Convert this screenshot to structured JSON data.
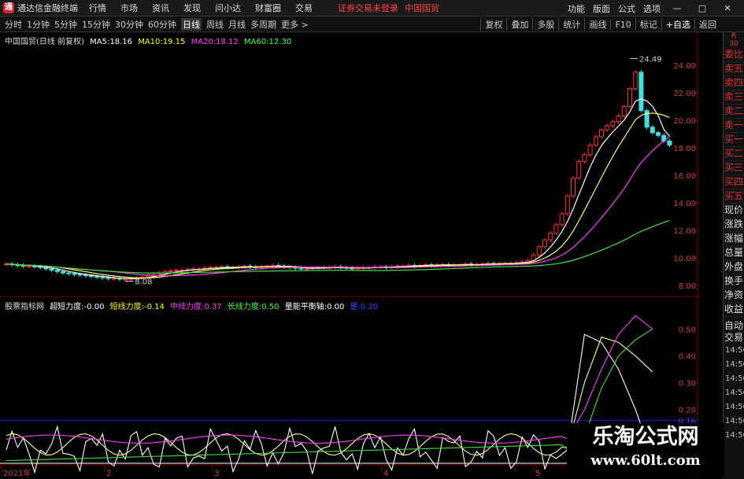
{
  "menubar": {
    "logo": "通",
    "app_title": "通达信金融终端",
    "items": [
      "行情",
      "市场",
      "资讯",
      "发现",
      "问小达",
      "财富圈",
      "交易"
    ],
    "warn1": "证券交易未登录",
    "warn2": "中国国贸",
    "right_items": [
      "功能",
      "版面",
      "公式",
      "选项"
    ],
    "window_controls": [
      "—",
      "□",
      "✕"
    ]
  },
  "toolbar": {
    "periods": [
      "分时",
      "1分钟",
      "5分钟",
      "15分钟",
      "30分钟",
      "60分钟",
      "日线",
      "周线",
      "月线",
      "多周期",
      "更多 >"
    ],
    "active_index": 6,
    "tools": [
      "复权",
      "叠加",
      "多股",
      "统计",
      "画线",
      "F10",
      "标记",
      "+自选",
      "返回"
    ]
  },
  "price_chart": {
    "name": "中国国贸(日线 前复权)",
    "ma_legend": [
      {
        "label": "MA5:",
        "value": "18.16",
        "color": "#ffffff"
      },
      {
        "label": "MA10:",
        "value": "19.15",
        "color": "#ffff00"
      },
      {
        "label": "MA20:",
        "value": "18.12",
        "color": "#ff40ff"
      },
      {
        "label": "MA60:",
        "value": "12.30",
        "color": "#40ff40"
      }
    ],
    "yticks": [
      "24.00",
      "22.00",
      "20.00",
      "18.00",
      "16.00",
      "14.00",
      "12.00",
      "10.00",
      "8.00"
    ],
    "ymin": 7.3,
    "ymax": 25.6,
    "high_label": "24.49",
    "low_label": "8.08"
  },
  "indicator": {
    "name": "股票指标网",
    "items": [
      {
        "label": "超短力度:",
        "value": "-0.00",
        "color": "#ffffff"
      },
      {
        "label": "短线力度:",
        "value": "-0.14",
        "color": "#ffff00"
      },
      {
        "label": "中线力度:",
        "value": "0.37",
        "color": "#ff40ff"
      },
      {
        "label": "长线力度:",
        "value": "0.50",
        "color": "#40ff40"
      },
      {
        "label": "量能平衡轴:",
        "value": "0.00",
        "color": "#ffffff"
      },
      {
        "label": "量:",
        "value": "0.20",
        "color": "#4040ff"
      }
    ],
    "yticks": [
      "0.50",
      "0.40",
      "0.30",
      "0.20",
      "0.16",
      "0.10"
    ],
    "cursor_value": "0.16"
  },
  "xaxis": {
    "labels": [
      "2021年",
      "2",
      "3",
      "4",
      "5"
    ]
  },
  "side": {
    "r_label": "R\n30",
    "items": [
      "委比",
      "卖五",
      "卖四",
      "卖三",
      "卖二",
      "卖一",
      "买一",
      "买二",
      "买三",
      "买四",
      "买五",
      "现价",
      "涨跌",
      "涨幅",
      "总量",
      "外盘",
      "换手",
      "净资",
      "收益"
    ],
    "auto": "自动",
    "auto2": "交易",
    "times": [
      "14:56",
      "14:56",
      "14:56",
      "14:56",
      "14:56",
      "14:56",
      "14:56"
    ]
  },
  "watermark": {
    "line1": "乐淘公式网",
    "line2": "www.60lt.com"
  },
  "colors": {
    "up": "#ff3030",
    "down": "#40e0e0",
    "grid": "#800000",
    "ma5": "#ffffff",
    "ma10": "#ffff60",
    "ma20": "#ff40ff",
    "ma60": "#40e040"
  }
}
